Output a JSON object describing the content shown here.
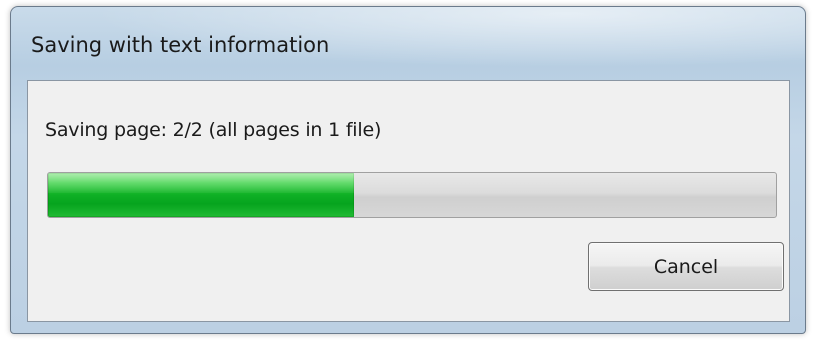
{
  "window": {
    "title": "Saving with text information"
  },
  "dialog": {
    "status_text": "Saving page: 2/2 (all pages in 1 file)",
    "progress": {
      "fraction": 0.42,
      "fill_color": "#0fb025"
    },
    "cancel_label": "Cancel"
  }
}
